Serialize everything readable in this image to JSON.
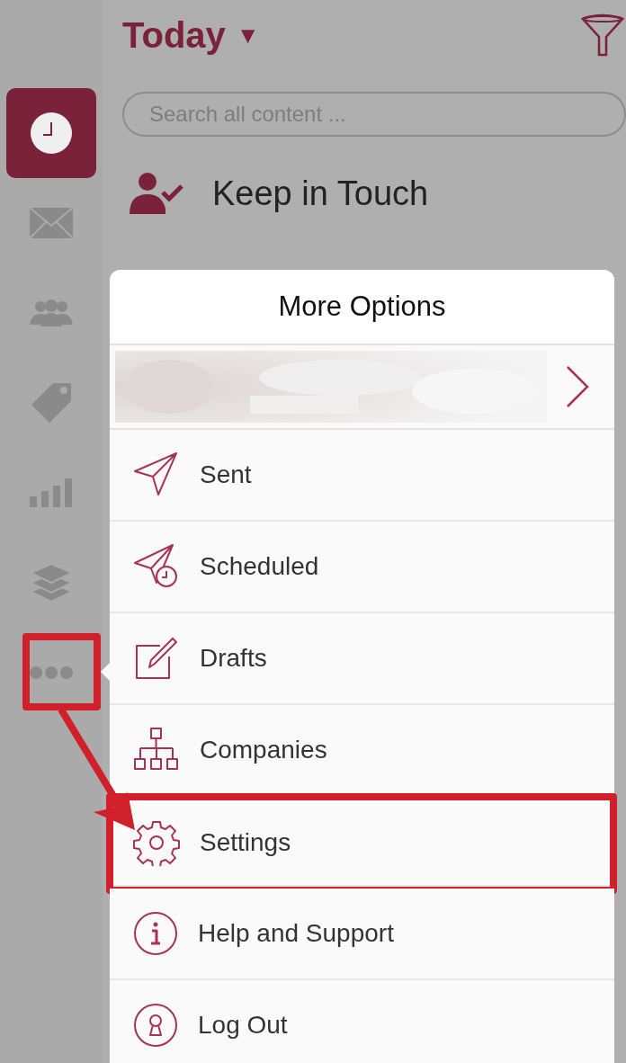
{
  "sidebar": {
    "items": [
      {
        "selected": true
      },
      {
        "selected": false
      },
      {
        "selected": false
      },
      {
        "selected": false
      },
      {
        "selected": false
      },
      {
        "selected": false
      },
      {
        "selected": false
      }
    ]
  },
  "header": {
    "title": "Today",
    "caret": "▼"
  },
  "search": {
    "placeholder": "Search all content ..."
  },
  "section": {
    "title": "Keep in Touch"
  },
  "menu": {
    "title": "More Options",
    "items": [
      {
        "label": "Sent",
        "highlighted": false
      },
      {
        "label": "Scheduled",
        "highlighted": false
      },
      {
        "label": "Drafts",
        "highlighted": false
      },
      {
        "label": "Companies",
        "highlighted": false
      },
      {
        "label": "Settings",
        "highlighted": true
      },
      {
        "label": "Help and Support",
        "highlighted": false
      },
      {
        "label": "Log Out",
        "highlighted": false
      }
    ]
  }
}
